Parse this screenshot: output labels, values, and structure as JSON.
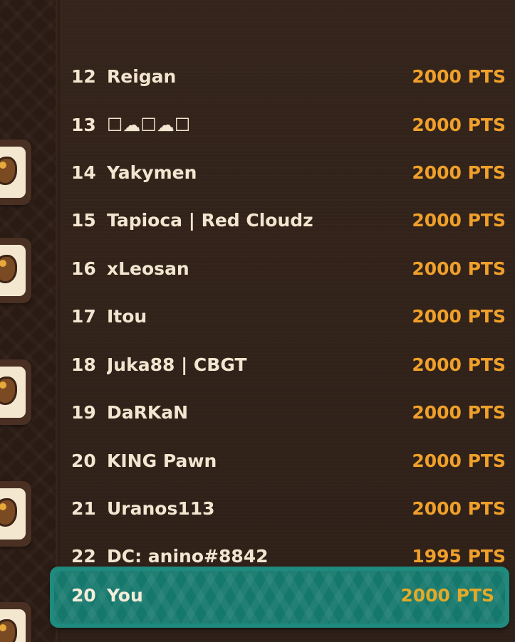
{
  "leaderboard": {
    "rows": [
      {
        "rank": "12",
        "name": "Reigan",
        "points": "2000 PTS"
      },
      {
        "rank": "13",
        "name": "☐☁☐☁☐",
        "points": "2000 PTS"
      },
      {
        "rank": "14",
        "name": "Yakymen",
        "points": "2000 PTS"
      },
      {
        "rank": "15",
        "name": "Tapioca | Red Cloudz",
        "points": "2000 PTS"
      },
      {
        "rank": "16",
        "name": "xLeosan",
        "points": "2000 PTS"
      },
      {
        "rank": "17",
        "name": "Itou",
        "points": "2000 PTS"
      },
      {
        "rank": "18",
        "name": "Juka88 | CBGT",
        "points": "2000 PTS"
      },
      {
        "rank": "19",
        "name": "DaRKaN",
        "points": "2000 PTS"
      },
      {
        "rank": "20",
        "name": "KING Pawn",
        "points": "2000 PTS"
      },
      {
        "rank": "21",
        "name": "Uranos113",
        "points": "2000 PTS"
      },
      {
        "rank": "22",
        "name": "DC: anino#8842",
        "points": "1995 PTS"
      }
    ],
    "current_player": {
      "rank": "20",
      "name": "You",
      "points": "2000 PTS"
    }
  },
  "colors": {
    "background": "#2c1d15",
    "points": "#f0a02a",
    "highlight_bar": "#1f8a7e",
    "name_text": "#f3e6d0"
  },
  "icons": {
    "avatar": "player-avatar-icon"
  }
}
